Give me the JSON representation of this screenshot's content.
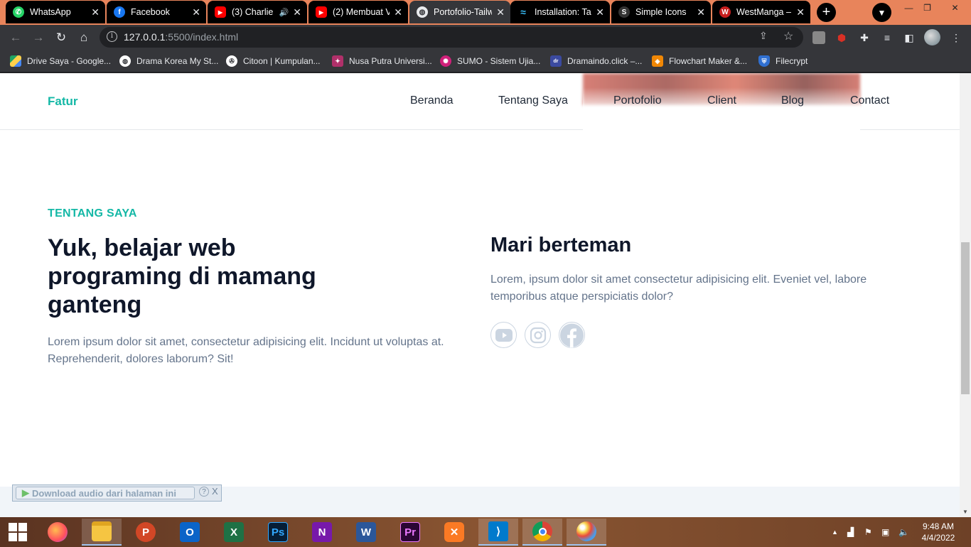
{
  "browser": {
    "tabs": [
      {
        "title": "WhatsApp",
        "icon": "whatsapp-icon",
        "color": "#25d366",
        "active": false
      },
      {
        "title": "Facebook",
        "icon": "facebook-icon",
        "color": "#1877f2",
        "active": false
      },
      {
        "title": "(3) Charlie",
        "icon": "youtube-icon",
        "color": "#ff0000",
        "active": false,
        "audio": true
      },
      {
        "title": "(2) Membuat V",
        "icon": "youtube-icon",
        "color": "#ff0000",
        "active": false
      },
      {
        "title": "Portofolio-Tailw",
        "icon": "globe-icon",
        "color": "#e8eaed",
        "active": true
      },
      {
        "title": "Installation: Tail",
        "icon": "tailwind-icon",
        "color": "#38bdf8",
        "active": false
      },
      {
        "title": "Simple Icons",
        "icon": "simpleicons-icon",
        "color": "#ffffff",
        "active": false
      },
      {
        "title": "WestManga –",
        "icon": "westmanga-icon",
        "color": "#c81e1e",
        "active": false
      }
    ],
    "url_host": "127.0.0.1",
    "url_rest": ":5500/index.html",
    "bookmarks": [
      {
        "label": "Drive Saya - Google...",
        "icon": "google-drive-icon",
        "color": "#1fa463"
      },
      {
        "label": "Drama Korea My St...",
        "icon": "globe-icon",
        "color": "#ffffff"
      },
      {
        "label": "Citoon | Kumpulan...",
        "icon": "film-reel-icon",
        "color": "#ffffff"
      },
      {
        "label": "Nusa Putra Universi...",
        "icon": "university-icon",
        "color": "#b0306a"
      },
      {
        "label": "SUMO - Sistem Ujia...",
        "icon": "sumo-icon",
        "color": "#d0207a"
      },
      {
        "label": "Dramaindo.click –...",
        "icon": "dramaindo-icon",
        "color": "#3b4aa0"
      },
      {
        "label": "Flowchart Maker &...",
        "icon": "drawio-icon",
        "color": "#f08705"
      },
      {
        "label": "Filecrypt",
        "icon": "shield-icon",
        "color": "#2f6fd0"
      }
    ]
  },
  "site": {
    "brand": "Fatur",
    "nav": [
      "Beranda",
      "Tentang Saya",
      "Portofolio",
      "Client",
      "Blog",
      "Contact"
    ],
    "about": {
      "eyebrow": "TENTANG SAYA",
      "headline": "Yuk, belajar web programing di mamang ganteng",
      "description": "Lorem ipsum dolor sit amet, consectetur adipisicing elit. Incidunt ut voluptas at. Reprehenderit, dolores laborum? Sit!",
      "subheading": "Mari berteman",
      "friend_description": "Lorem, ipsum dolor sit amet consectetur adipisicing elit. Eveniet vel, labore temporibus atque perspiciatis dolor?",
      "socials": [
        "youtube-icon",
        "instagram-icon",
        "facebook-icon"
      ]
    }
  },
  "audio_bar": {
    "label": "Download audio dari halaman ini",
    "help": "?",
    "close": "X"
  },
  "taskbar": {
    "apps": [
      "firefox-icon",
      "file-explorer-icon",
      "powerpoint-icon",
      "outlook-icon",
      "excel-icon",
      "photoshop-icon",
      "onenote-icon",
      "word-icon",
      "premiere-icon",
      "xampp-icon",
      "vscode-icon",
      "chrome-icon",
      "paint-icon"
    ],
    "time": "9:48 AM",
    "date": "4/4/2022"
  }
}
